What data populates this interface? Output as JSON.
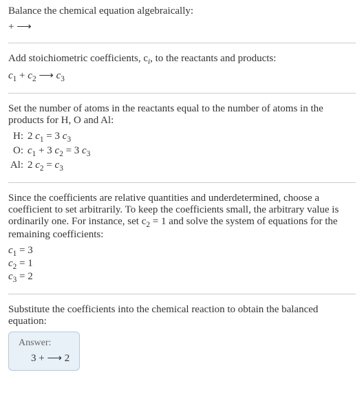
{
  "section1": {
    "title": "Balance the chemical equation algebraically:",
    "formula": " +  ⟶"
  },
  "section2": {
    "title": "Add stoichiometric coefficients, c",
    "title_sub": "i",
    "title_after": ", to the reactants and products:",
    "formula_parts": {
      "c1": "c",
      "c1_sub": "1",
      "plus1": "  + ",
      "c2": "c",
      "c2_sub": "2",
      "arrow": "  ⟶ ",
      "c3": "c",
      "c3_sub": "3"
    }
  },
  "section3": {
    "title": "Set the number of atoms in the reactants equal to the number of atoms in the products for H, O and Al:",
    "rows": [
      {
        "label": "H:",
        "lhs_coef": "2 ",
        "lhs_var": "c",
        "lhs_sub": "1",
        "eq": " = ",
        "rhs_coef": "3 ",
        "rhs_var": "c",
        "rhs_sub": "3"
      },
      {
        "label": "O:",
        "lhs1_var": "c",
        "lhs1_sub": "1",
        "plus": " + ",
        "lhs2_coef": "3 ",
        "lhs2_var": "c",
        "lhs2_sub": "2",
        "eq": " = ",
        "rhs_coef": "3 ",
        "rhs_var": "c",
        "rhs_sub": "3"
      },
      {
        "label": "Al:",
        "lhs_coef": "2 ",
        "lhs_var": "c",
        "lhs_sub": "2",
        "eq": " = ",
        "rhs_var": "c",
        "rhs_sub": "3"
      }
    ]
  },
  "section4": {
    "title": "Since the coefficients are relative quantities and underdetermined, choose a coefficient to set arbitrarily. To keep the coefficients small, the arbitrary value is ordinarily one. For instance, set c",
    "title_sub": "2",
    "title_after": " = 1 and solve the system of equations for the remaining coefficients:",
    "results": [
      {
        "var": "c",
        "sub": "1",
        "eq": " = ",
        "val": "3"
      },
      {
        "var": "c",
        "sub": "2",
        "eq": " = ",
        "val": "1"
      },
      {
        "var": "c",
        "sub": "3",
        "eq": " = ",
        "val": "2"
      }
    ]
  },
  "section5": {
    "title": "Substitute the coefficients into the chemical reaction to obtain the balanced equation:",
    "answer_label": "Answer:",
    "answer_formula": "3  +  ⟶ 2"
  }
}
